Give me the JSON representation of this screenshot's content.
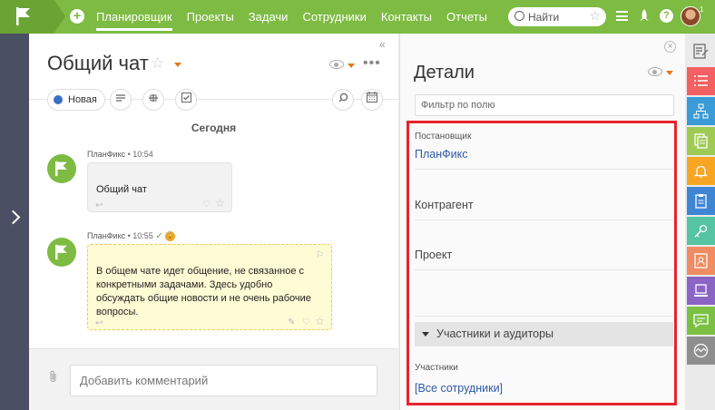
{
  "header": {
    "nav": [
      "Планировщик",
      "Проекты",
      "Задачи",
      "Сотрудники",
      "Контакты",
      "Отчеты"
    ],
    "active_nav": "Планировщик",
    "search_placeholder": "Найти",
    "notification_count": "1"
  },
  "chat": {
    "title": "Общий чат",
    "status_label": "Новая",
    "day_label": "Сегодня",
    "messages": [
      {
        "author": "ПланФикс",
        "time": "10:54",
        "text": "Общий чат"
      },
      {
        "author": "ПланФикс",
        "time": "10:55",
        "text": "В общем чате идет общение, не связанное с конкретными задачами. Здесь удобно обсуждать общие новости и не очень рабочие вопросы."
      }
    ],
    "comment_placeholder": "Добавить комментарий"
  },
  "details": {
    "title": "Детали",
    "filter_placeholder": "Фильтр по полю",
    "assigner_label": "Постановщик",
    "assigner_value": "ПланФикс",
    "contractor_label": "Контрагент",
    "project_label": "Проект",
    "participants_section": "Участники и аудиторы",
    "participants_label": "Участники",
    "participants_value": "[Все сотрудники]"
  },
  "colors": {
    "topbar": "#7dbb42",
    "leftstrip": "#4b4f63",
    "highlight_border": "#e5242d",
    "link": "#2d5aa5",
    "strip_tiles": [
      "#f26062",
      "#3a9bd6",
      "#9ecb54",
      "#f6a623",
      "#3e86d5",
      "#55c4a0",
      "#f08c61",
      "#8b64c6",
      "#7bc043",
      "#8e8e8e"
    ]
  },
  "icons": {
    "strip": [
      "list-icon",
      "structure-icon",
      "documents-icon",
      "bell-icon",
      "clipboard-icon",
      "key-icon",
      "contact-card-icon",
      "stamp-icon",
      "chat-icon",
      "activity-icon"
    ]
  }
}
